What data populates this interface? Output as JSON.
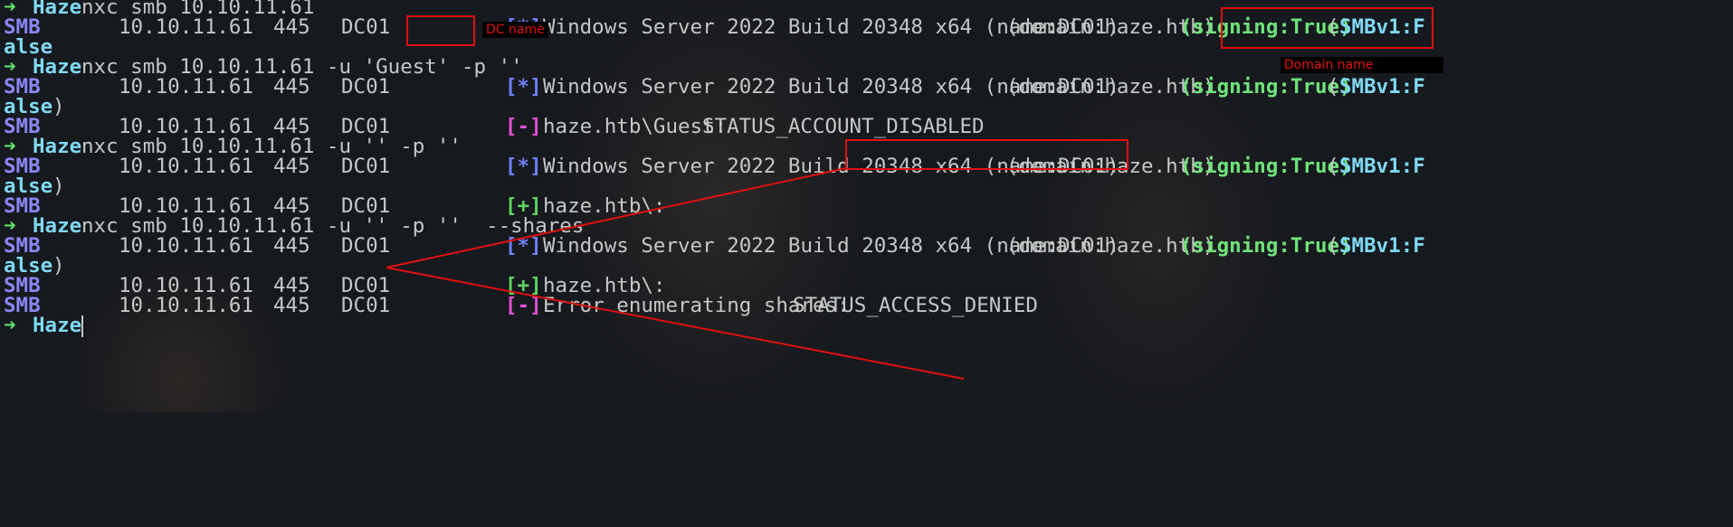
{
  "terminal": {
    "prompt": {
      "arrow": "➜",
      "host": "Haze"
    },
    "commands": [
      "nxc smb 10.10.11.61",
      "nxc smb 10.10.11.61 -u 'Guest' -p ''",
      "nxc smb 10.10.11.61 -u '' -p ''",
      "nxc smb 10.10.11.61 -u '' -p ''  --shares"
    ],
    "smb_label": "SMB",
    "ip": "10.10.11.61",
    "port": "445",
    "dc": "DC01",
    "marks": {
      "star": "[*]",
      "plus": "[+]",
      "minus": "[-]"
    },
    "banner_text": "Windows Server 2022 Build 20348 x64 (name:DC01)",
    "domain_text": "(domain:haze.htb)",
    "signing_text": "(signing:True)",
    "smbv1_open": "(",
    "smbv1_text": "SMBv1:F",
    "wrap_text": "alse",
    "wrap_close": ")",
    "guest_prefix": "haze.htb\\Guest: ",
    "guest_status": "STATUS_ACCOUNT_DISABLED",
    "null_result": "haze.htb\\:",
    "shares_error_prefix": "Error enumerating shares: ",
    "shares_error_status": "STATUS_ACCESS_DENIED"
  },
  "annotations": {
    "dc_name_label": "DC name",
    "domain_name_label": "Domain name",
    "color": "#e01010"
  }
}
